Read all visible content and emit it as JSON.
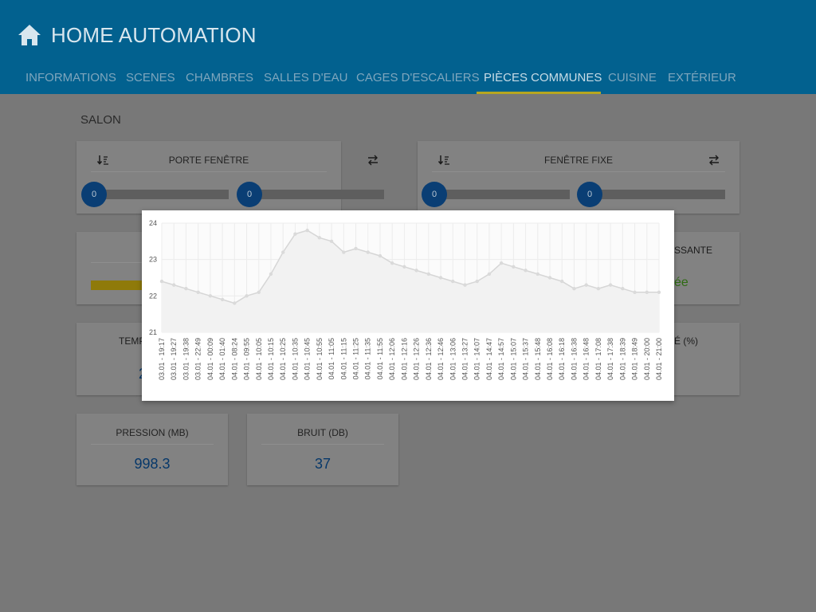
{
  "app": {
    "title": "HOME AUTOMATION",
    "icon": "home-icon",
    "colors": {
      "header": "#02618f",
      "tab_indicator": "#b7a620",
      "value": "#07386a",
      "knob": "#0a3e74"
    }
  },
  "tabs": [
    {
      "label": "INFORMATIONS",
      "active": false
    },
    {
      "label": "SCENES",
      "active": false
    },
    {
      "label": "CHAMBRES",
      "active": false
    },
    {
      "label": "SALLES D'EAU",
      "active": false
    },
    {
      "label": "CAGES D'ESCALIERS",
      "active": false
    },
    {
      "label": "PIÈCES COMMUNES",
      "active": true
    },
    {
      "label": "CUISINE",
      "active": false
    },
    {
      "label": "EXTÉRIEUR",
      "active": false
    }
  ],
  "section": {
    "title": "SALON"
  },
  "shutters": [
    {
      "title": "PORTE FENÊTRE",
      "left_value": "0",
      "right_value": "0",
      "left_icon": "sort-down-icon",
      "right_icon": "swap-icon"
    },
    {
      "title": "FENÊTRE FIXE",
      "left_value": "0",
      "right_value": "0",
      "left_icon": "sort-down-icon",
      "right_icon": "swap-icon"
    }
  ],
  "partial": {
    "right_card_title": "SSANTE",
    "right_card_value": "ée",
    "temp_label": "TEMP",
    "temp_value_fragment": "2",
    "humidity_label_fragment": "É (%)"
  },
  "sensors": [
    {
      "title": "PRESSION (MB)",
      "value": "998.3"
    },
    {
      "title": "BRUIT (DB)",
      "value": "37"
    }
  ],
  "chart_data": {
    "type": "area",
    "ylim": [
      21,
      24
    ],
    "yticks": [
      "21",
      "22",
      "23",
      "24"
    ],
    "grid": true,
    "x": [
      "03.01 - 19:17",
      "03.01 - 19:27",
      "03.01 - 19:38",
      "03.01 - 22:49",
      "04.01 - 00:09",
      "04.01 - 01:40",
      "04.01 - 08:24",
      "04.01 - 09:55",
      "04.01 - 10:05",
      "04.01 - 10:15",
      "04.01 - 10:25",
      "04.01 - 10:35",
      "04.01 - 10:45",
      "04.01 - 10:55",
      "04.01 - 11:05",
      "04.01 - 11:15",
      "04.01 - 11:25",
      "04.01 - 11:35",
      "04.01 - 11:55",
      "04.01 - 12:06",
      "04.01 - 12:16",
      "04.01 - 12:26",
      "04.01 - 12:36",
      "04.01 - 12:46",
      "04.01 - 13:06",
      "04.01 - 13:27",
      "04.01 - 14:07",
      "04.01 - 14:47",
      "04.01 - 14:57",
      "04.01 - 15:07",
      "04.01 - 15:37",
      "04.01 - 15:48",
      "04.01 - 16:08",
      "04.01 - 16:18",
      "04.01 - 16:38",
      "04.01 - 16:48",
      "04.01 - 17:08",
      "04.01 - 17:38",
      "04.01 - 18:39",
      "04.01 - 18:49",
      "04.01 - 20:00",
      "04.01 - 21:00"
    ],
    "series": [
      {
        "values": [
          22.4,
          22.3,
          22.2,
          22.1,
          22.0,
          21.9,
          21.8,
          22.0,
          22.1,
          22.6,
          23.2,
          23.7,
          23.8,
          23.6,
          23.5,
          23.2,
          23.3,
          23.2,
          23.1,
          22.9,
          22.8,
          22.7,
          22.6,
          22.5,
          22.4,
          22.3,
          22.4,
          22.6,
          22.9,
          22.8,
          22.7,
          22.6,
          22.5,
          22.4,
          22.2,
          22.3,
          22.2,
          22.3,
          22.2,
          22.1,
          22.1,
          22.1
        ]
      }
    ],
    "colors": {
      "line": "#d6d6d6",
      "fill": "#f2f2f2",
      "point": "#dadada",
      "grid": "#ececec"
    }
  }
}
